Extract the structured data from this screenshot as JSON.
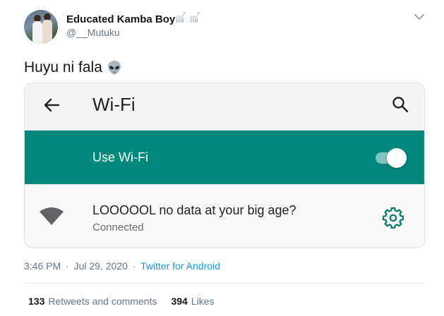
{
  "author": {
    "name": "Educated Kamba Boy",
    "handle": "@__Mutuku",
    "name_emojis": [
      "goat-emoji",
      "goat-emoji"
    ]
  },
  "tweet": {
    "text": "Huyu ni fala",
    "emoji": "alien-emoji"
  },
  "screenshot": {
    "title": "Wi-Fi",
    "use_wifi_label": "Use Wi-Fi",
    "use_wifi_on": true,
    "network_name": "LOOOOOL no data at your big age?",
    "network_status": "Connected",
    "colors": {
      "band": "#00897b",
      "gear": "#00796b"
    }
  },
  "meta": {
    "time": "3:46 PM",
    "separator": "·",
    "date": "Jul 29, 2020",
    "source": "Twitter for Android"
  },
  "stats": {
    "retweets_count": "133",
    "retweets_label": "Retweets and comments",
    "likes_count": "394",
    "likes_label": "Likes"
  }
}
